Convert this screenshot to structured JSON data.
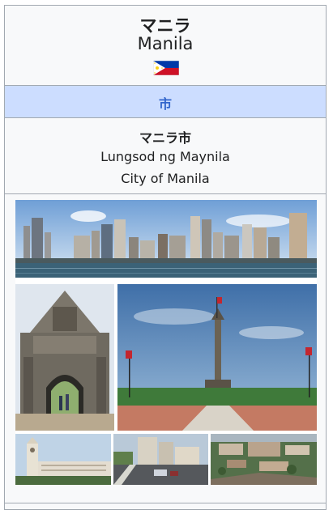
{
  "infobox": {
    "title_native": "マニラ",
    "title_english": "Manila",
    "flag": "philippines-flag",
    "settlement_type": "市",
    "official_name_ja": "マニラ市",
    "official_name_local": "Lungsod ng Maynila",
    "official_name_en": "City of Manila"
  },
  "collage": {
    "photos": [
      "manila-skyline-bay-photo",
      "fort-santiago-gate-photo",
      "rizal-monument-photo",
      "manila-city-hall-clock-tower-photo",
      "roxas-boulevard-street-photo",
      "intramuros-aerial-photo"
    ]
  },
  "colors": {
    "header_band": "#ccddff",
    "header_text": "#3366cc",
    "border": "#a2a9b1",
    "background": "#f8f9fa"
  }
}
